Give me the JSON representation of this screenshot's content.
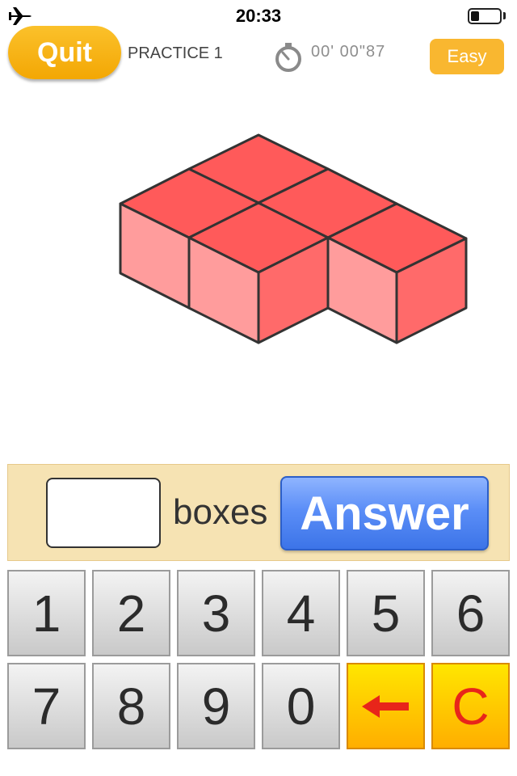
{
  "status_bar": {
    "time": "20:33",
    "battery_level": 0.3,
    "icons": [
      "airplane-icon",
      "battery-icon"
    ]
  },
  "header": {
    "quit_label": "Quit",
    "practice_label": "PRACTICE 1",
    "timer_text": "00' 00\"87",
    "difficulty_label": "Easy",
    "icons": [
      "stopwatch-icon"
    ]
  },
  "puzzle": {
    "shape": "isometric stacked boxes",
    "box_top_color": "#ff5a5a",
    "box_left_color": "#ff9c9c",
    "box_right_color": "#ff6a6a",
    "edge_color": "#333333"
  },
  "answer": {
    "input_value": "",
    "unit_label": "boxes",
    "submit_label": "Answer"
  },
  "keypad": {
    "row1": [
      "1",
      "2",
      "3",
      "4",
      "5",
      "6"
    ],
    "row2": [
      "7",
      "8",
      "9",
      "0"
    ],
    "clear_label": "C",
    "backspace_icon": "left-arrow-icon",
    "clear_color": "#e8251a",
    "special_key_color": "#ffc800"
  }
}
